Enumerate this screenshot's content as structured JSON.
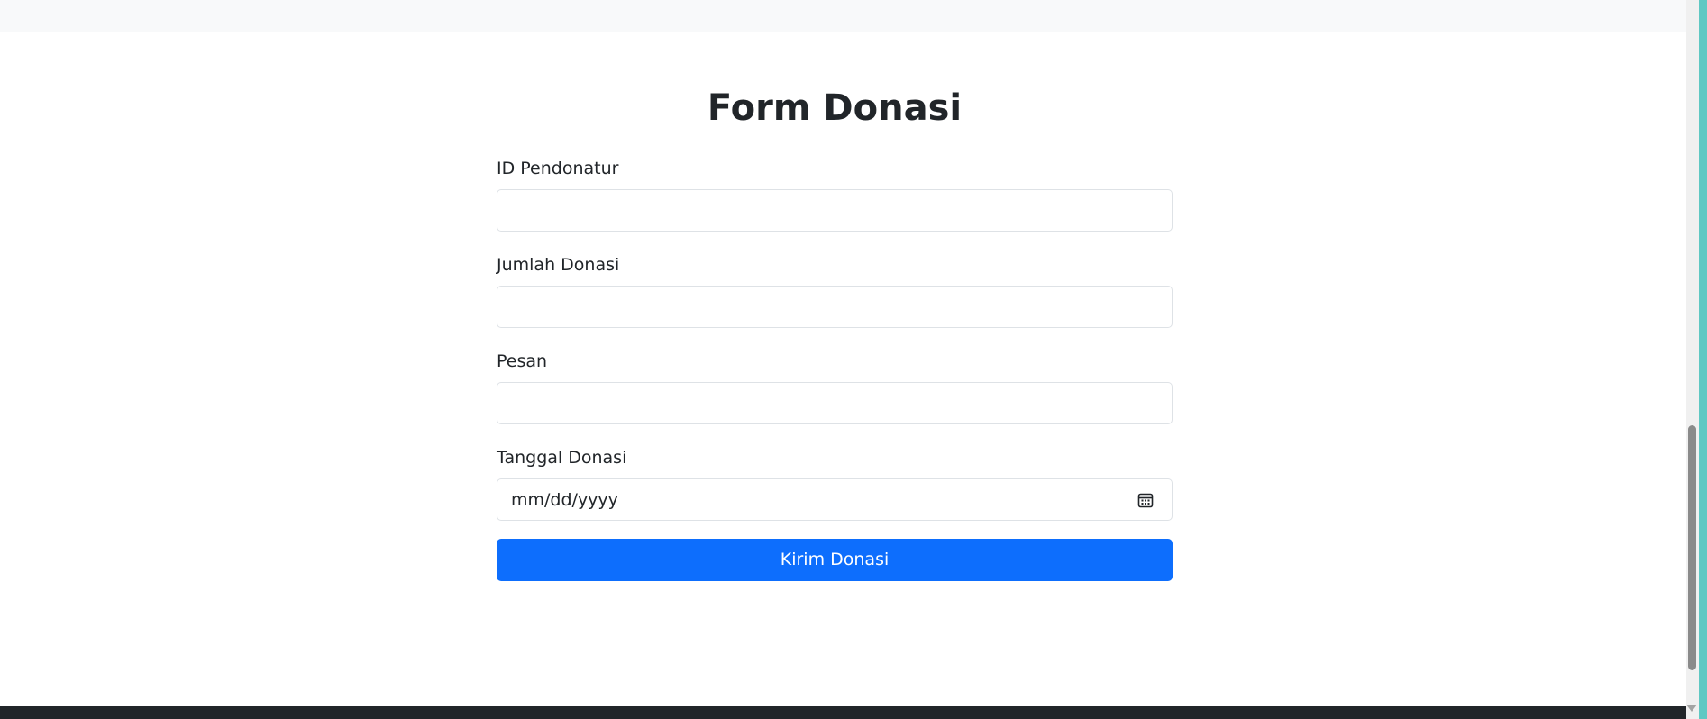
{
  "form": {
    "title": "Form Donasi",
    "fields": [
      {
        "label": "ID Pendonatur",
        "value": ""
      },
      {
        "label": "Jumlah Donasi",
        "value": ""
      },
      {
        "label": "Pesan",
        "value": ""
      },
      {
        "label": "Tanggal Donasi",
        "value": "mm/dd/yyyy"
      }
    ],
    "submit_label": "Kirim Donasi"
  },
  "icons": {
    "calendar": "calendar-icon"
  },
  "colors": {
    "primary": "#0d6efd",
    "header_bg": "#f8f9fa",
    "footer_bg": "#212529",
    "input_border": "#dee2e6"
  }
}
